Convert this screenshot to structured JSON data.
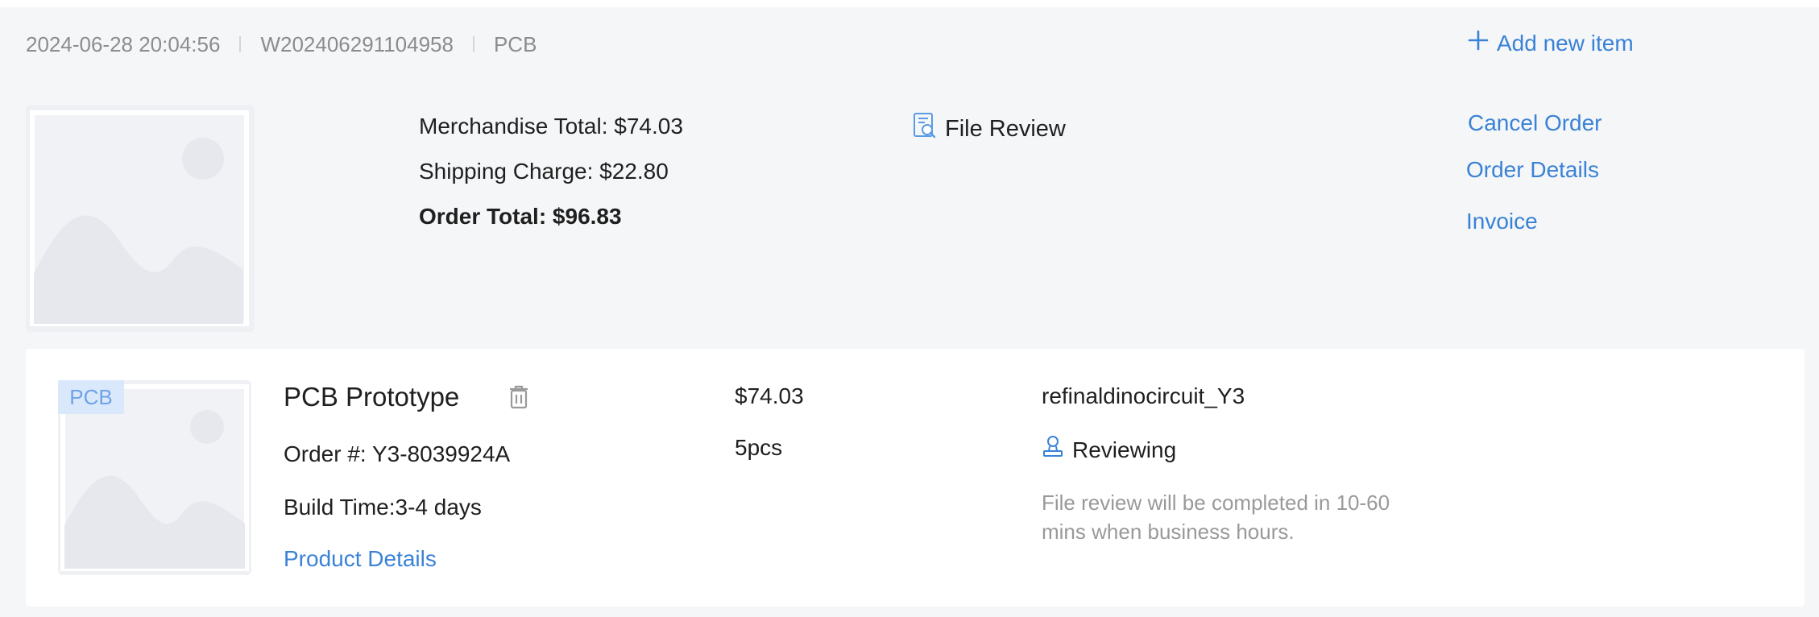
{
  "order": {
    "datetime": "2024-06-28 20:04:56",
    "order_number": "W202406291104958",
    "category": "PCB",
    "add_item_label": "Add new item",
    "merchandise_total": "Merchandise Total: $74.03",
    "shipping_charge": "Shipping Charge: $22.80",
    "order_total": "Order Total: $96.83",
    "file_review_label": "File Review",
    "actions": {
      "cancel": "Cancel Order",
      "details": "Order Details",
      "invoice": "Invoice"
    }
  },
  "item": {
    "tag": "PCB",
    "title": "PCB Prototype",
    "order_ref": "Order #: Y3-8039924A",
    "build_time": "Build Time:3-4 days",
    "details_link": "Product Details",
    "price": "$74.03",
    "quantity": "5pcs",
    "username": "refinaldinocircuit_Y3",
    "status": "Reviewing",
    "status_note": "File review will be completed in 10-60 mins when business hours."
  },
  "colors": {
    "accent": "#3a82d6",
    "card_bg": "#f5f6f8",
    "muted_text": "#8c8c8c",
    "tag_bg": "#d9e8fb"
  },
  "icons": [
    "plus-icon",
    "image-placeholder-icon",
    "file-review-icon",
    "trash-icon",
    "reviewer-stamp-icon"
  ]
}
